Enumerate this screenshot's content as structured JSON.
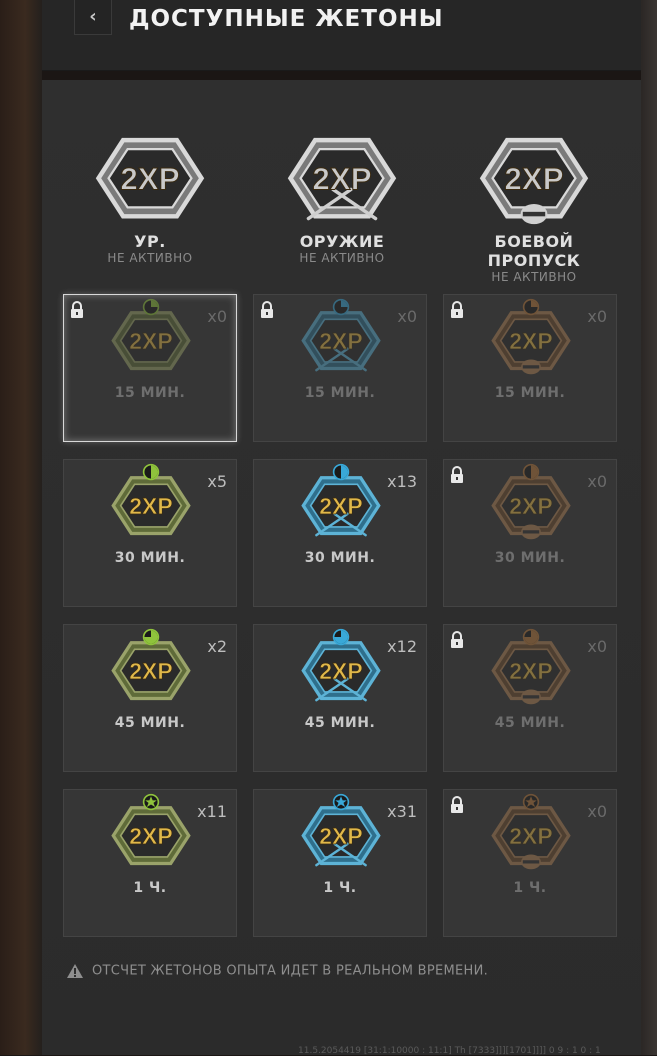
{
  "header": {
    "back_label": "‹",
    "title": "ДОСТУПНЫЕ ЖЕТОНЫ"
  },
  "columns": [
    {
      "name": "УР.",
      "status": "НЕ АКТИВНО",
      "type": "rank",
      "accent": "#8fc33c"
    },
    {
      "name": "ОРУЖИЕ",
      "status": "НЕ АКТИВНО",
      "type": "weapon",
      "accent": "#39a8d8"
    },
    {
      "name": "БОЕВОЙ ПРОПУСК",
      "status": "НЕ АКТИВНО",
      "type": "battlepass",
      "accent": "#b5783b"
    }
  ],
  "rows": [
    {
      "cards": [
        {
          "count": "x0",
          "duration": "15 МИН.",
          "locked": true,
          "selected": true,
          "icon": "clock-quarter-icon"
        },
        {
          "count": "x0",
          "duration": "15 МИН.",
          "locked": true,
          "icon": "clock-quarter-icon"
        },
        {
          "count": "x0",
          "duration": "15 МИН.",
          "locked": true,
          "icon": "clock-quarter-icon"
        }
      ]
    },
    {
      "cards": [
        {
          "count": "x5",
          "duration": "30 МИН.",
          "locked": false,
          "icon": "clock-half-icon"
        },
        {
          "count": "x13",
          "duration": "30 МИН.",
          "locked": false,
          "icon": "clock-half-icon"
        },
        {
          "count": "x0",
          "duration": "30 МИН.",
          "locked": true,
          "icon": "clock-half-icon"
        }
      ]
    },
    {
      "cards": [
        {
          "count": "x2",
          "duration": "45 МИН.",
          "locked": false,
          "icon": "clock-three-quarter-icon"
        },
        {
          "count": "x12",
          "duration": "45 МИН.",
          "locked": false,
          "icon": "clock-three-quarter-icon"
        },
        {
          "count": "x0",
          "duration": "45 МИН.",
          "locked": true,
          "icon": "clock-three-quarter-icon"
        }
      ]
    },
    {
      "cards": [
        {
          "count": "x11",
          "duration": "1 Ч.",
          "locked": false,
          "icon": "star-icon"
        },
        {
          "count": "x31",
          "duration": "1 Ч.",
          "locked": false,
          "icon": "star-icon"
        },
        {
          "count": "x0",
          "duration": "1 Ч.",
          "locked": true,
          "icon": "star-icon"
        }
      ]
    }
  ],
  "note": "ОТСЧЕТ ЖЕТОНОВ ОПЫТА ИДЕТ В РЕАЛЬНОМ ВРЕМЕНИ.",
  "footer": "11.5.2054419 [31:1:10000 : 11:1] Th [7333]]][1701]]]] 0 9 : 1 0 : 1"
}
